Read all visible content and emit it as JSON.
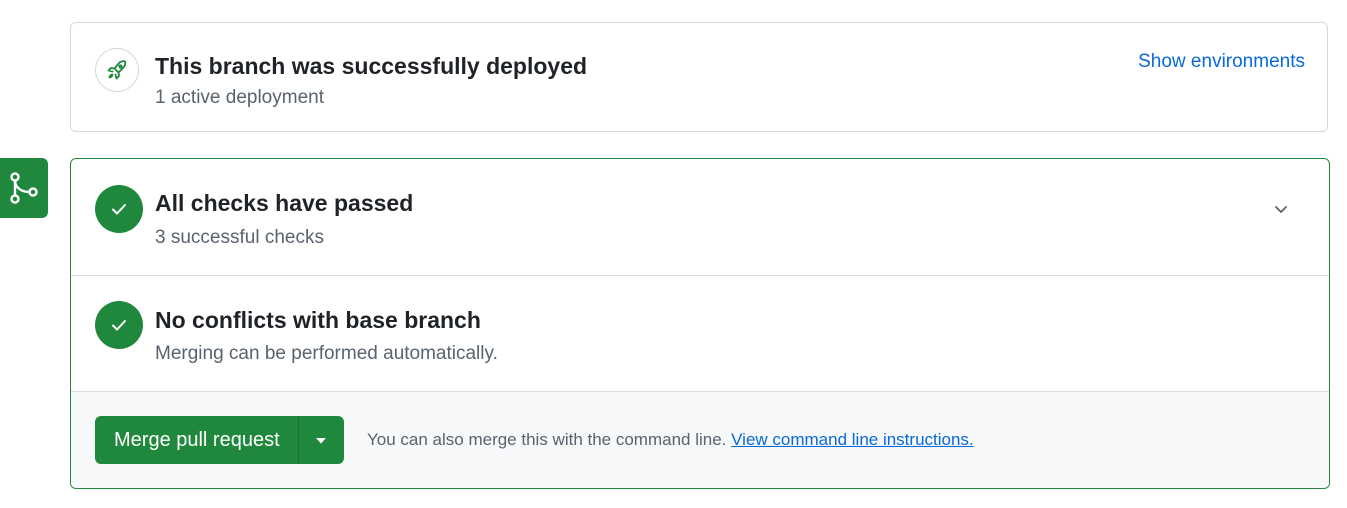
{
  "deployment": {
    "title": "This branch was successfully deployed",
    "subtitle": "1 active deployment",
    "action_label": "Show environments",
    "icon": "rocket-icon"
  },
  "merge_panel": {
    "side_icon": "git-merge-icon",
    "checks": {
      "title": "All checks have passed",
      "subtitle": "3 successful checks",
      "icon": "check-icon",
      "toggle_icon": "chevron-down-icon"
    },
    "conflicts": {
      "title": "No conflicts with base branch",
      "subtitle": "Merging can be performed automatically.",
      "icon": "check-icon"
    },
    "merge": {
      "button_label": "Merge pull request",
      "dropdown_icon": "triangle-down-icon",
      "helper_text": "You can also merge this with the command line.",
      "link_text": "View command line instructions."
    }
  },
  "colors": {
    "success": "#1f883d",
    "link": "#0969da",
    "border": "#d0d7de",
    "muted_text": "#59636e"
  }
}
